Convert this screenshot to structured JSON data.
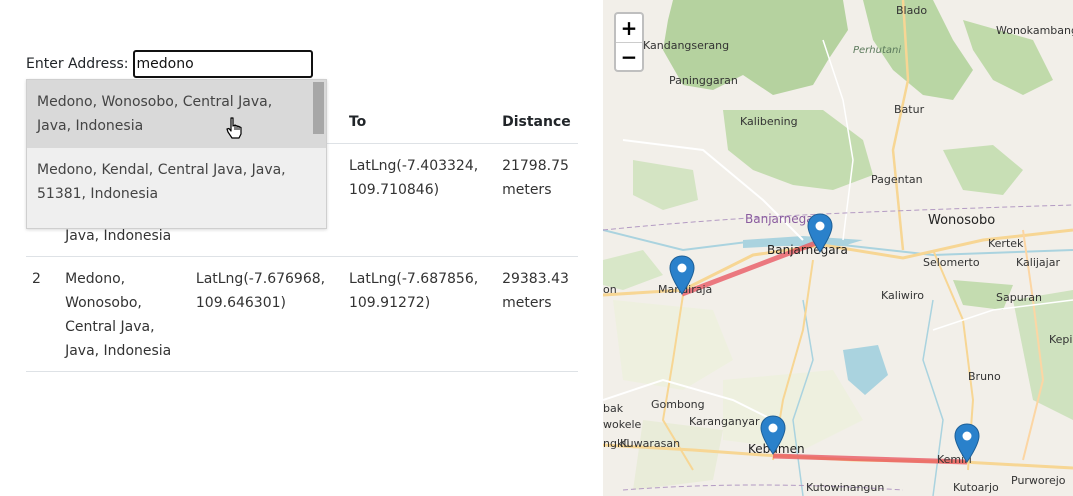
{
  "form": {
    "address_label": "Enter Address:",
    "address_value": "medono"
  },
  "suggestions": [
    {
      "text": "Medono, Wonosobo, Central Java, Java, Indonesia"
    },
    {
      "text": "Medono, Kendal, Central Java, Java, 51381, Indonesia"
    }
  ],
  "table": {
    "headers": {
      "to": "To",
      "distance": "Distance"
    },
    "rows": [
      {
        "idx": "",
        "address": "Java, Indonesia",
        "from": "",
        "to": "LatLng(-7.403324, 109.710846)",
        "distance": "21798.75 meters"
      },
      {
        "idx": "2",
        "address": "Medono, Wonosobo, Central Java, Java, Indonesia",
        "from": "LatLng(-7.676968, 109.646301)",
        "to": "LatLng(-7.687856, 109.91272)",
        "distance": "29383.43 meters"
      }
    ]
  },
  "map": {
    "zoom_in": "+",
    "zoom_out": "−",
    "labels": {
      "blado": "Blado",
      "wonokambang": "Wonokambang",
      "kandangserang": "Kandangserang",
      "perhutani": "Perhutani",
      "paninggaran": "Paninggaran",
      "batur": "Batur",
      "kalibening": "Kalibening",
      "pagentan": "Pagentan",
      "banjarnegara_region": "Banjarnegara",
      "wonosobo": "Wonosobo",
      "kertek": "Kertek",
      "banjarnegara": "Banjarnegara",
      "selomerto": "Selomerto",
      "kalijajar": "Kalijajar",
      "mandiraja": "Mandiraja",
      "kaliwiro": "Kaliwiro",
      "sapuran": "Sapuran",
      "kepil": "Kepil",
      "bruno": "Bruno",
      "gombong": "Gombong",
      "karanganyar": "Karanganyar",
      "kuwarasan": "Kuwarasan",
      "kebumen": "Kebumen",
      "kemiri": "Kemiri",
      "kutowinangun": "Kutowinangun",
      "kutoarjo": "Kutoarjo",
      "purworejo": "Purworejo",
      "edge_on": "on",
      "edge_bak": "bak",
      "edge_wokele": "wokele",
      "edge_ngkil": "ngkil"
    },
    "route_color": "#e8505b",
    "marker_color": "#2a81cb"
  }
}
